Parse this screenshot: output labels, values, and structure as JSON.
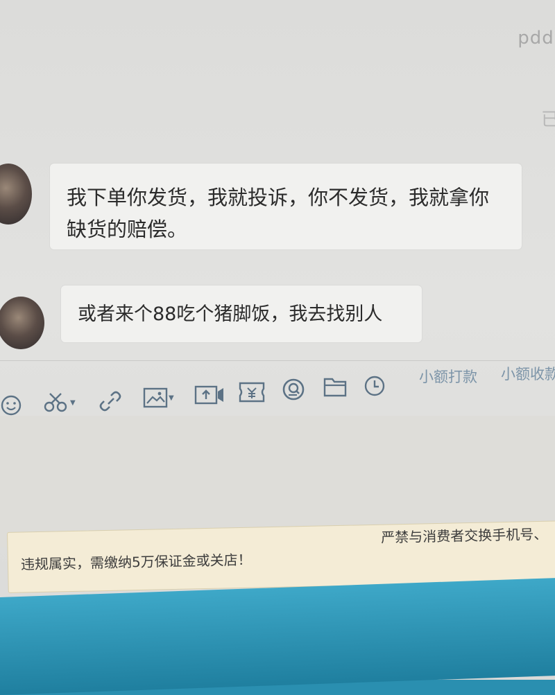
{
  "header": {
    "contact_name": "pdd.",
    "status": "已"
  },
  "messages": [
    {
      "text": "我下单你发货，我就投诉，你不发货，我就拿你缺货的赔偿。"
    },
    {
      "text": "或者来个88吃个猪脚饭，我去找别人"
    }
  ],
  "toolbar": {
    "icons": [
      "emoji-icon",
      "scissors-icon",
      "link-icon",
      "image-icon",
      "video-icon",
      "coupon-icon",
      "search-order-icon",
      "folder-icon",
      "clock-icon"
    ],
    "small_payment_label": "小额打款",
    "small_receive_label": "小额收款"
  },
  "notice": {
    "left_text": "违规属实，需缴纳5万保证金或关店！",
    "right_text": "严禁与消费者交换手机号、"
  },
  "colors": {
    "icon": "#5c7285",
    "bubble": "#f1f1ef",
    "notice_bg": "#f4ecd6",
    "desktop": "#2a8fb0"
  }
}
